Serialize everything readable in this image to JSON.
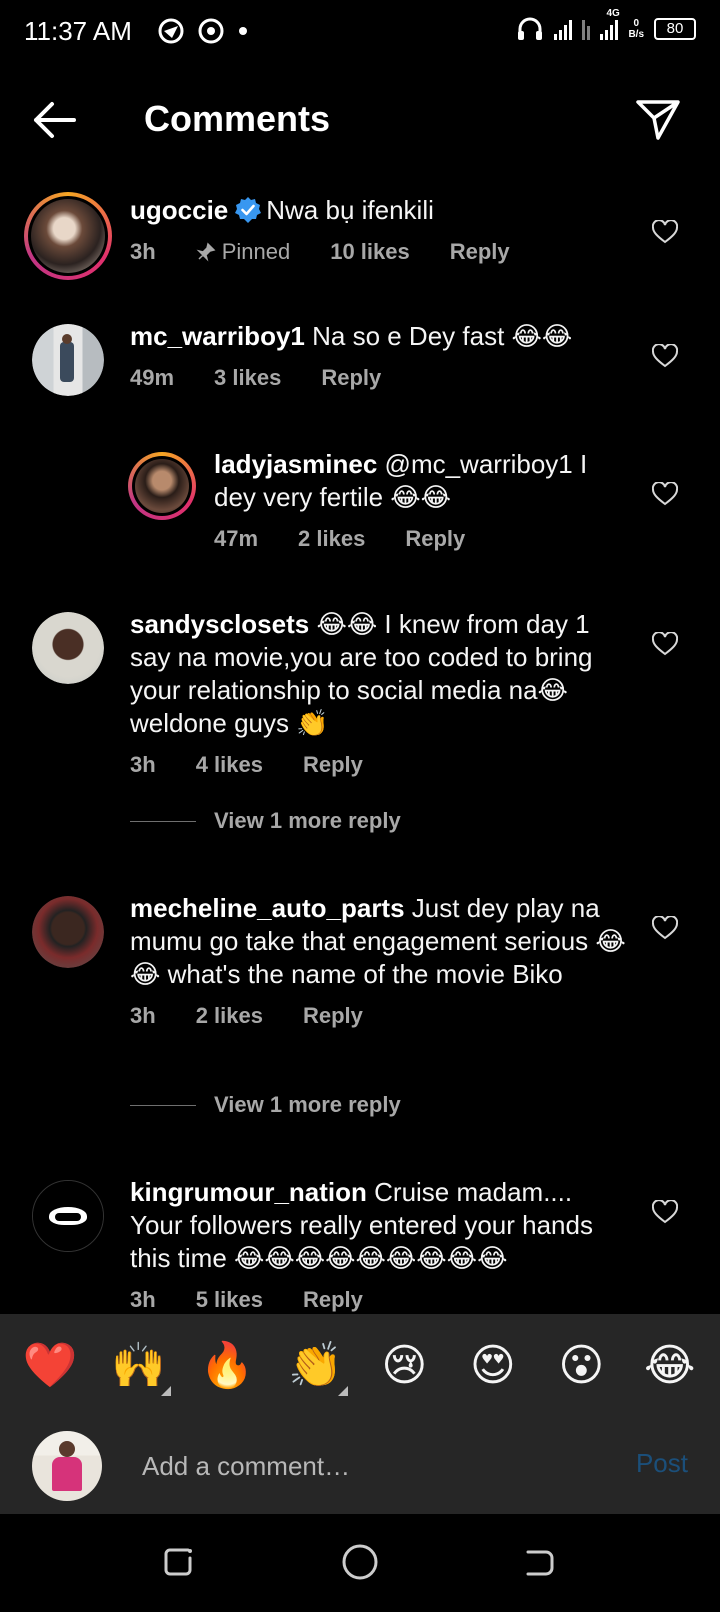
{
  "status_bar": {
    "time": "11:37 AM",
    "network": "4G",
    "speed_value": "0",
    "speed_unit": "B/s",
    "battery": "80"
  },
  "header": {
    "title": "Comments"
  },
  "comments": [
    {
      "username": "ugoccie",
      "verified": true,
      "text": "Nwa bụ ifenkili",
      "time": "3h",
      "pinned_label": "Pinned",
      "likes": "10 likes",
      "reply_label": "Reply"
    },
    {
      "username": "mc_warriboy1",
      "text": "Na so e Dey fast 😂😂",
      "time": "49m",
      "likes": "3 likes",
      "reply_label": "Reply"
    },
    {
      "username": "ladyjasminec",
      "text": "@mc_warriboy1 I dey very fertile 😂😂",
      "time": "47m",
      "likes": "2 likes",
      "reply_label": "Reply"
    },
    {
      "username": "sandysclosets",
      "text": "😂😂 I knew  from day 1 say na movie,you are too coded to bring your  relationship to social media na😂 weldone guys 👏",
      "time": "3h",
      "likes": "4 likes",
      "reply_label": "Reply",
      "view_more": "View 1 more reply"
    },
    {
      "username": "mecheline_auto_parts",
      "text": "Just dey play na mumu go take that engagement serious 😂😂 what's the name of the movie Biko",
      "time": "3h",
      "likes": "2 likes",
      "reply_label": "Reply",
      "view_more": "View 1 more reply"
    },
    {
      "username": "kingrumour_nation",
      "text": "Cruise madam.... Your followers really entered your hands this time 😂😂😂😂😂😂😂😂😂",
      "time": "3h",
      "likes": "5 likes",
      "reply_label": "Reply"
    }
  ],
  "emoji_bar": [
    "❤️",
    "🙌",
    "🔥",
    "👏",
    "😢",
    "😍",
    "😮",
    "😂"
  ],
  "input": {
    "placeholder": "Add a comment…",
    "post_label": "Post"
  },
  "colors": {
    "background": "#000000",
    "panel": "#262626",
    "secondary_text": "#a8a8a8",
    "verified_blue": "#3897f0",
    "post_disabled": "#1b4f7a"
  }
}
